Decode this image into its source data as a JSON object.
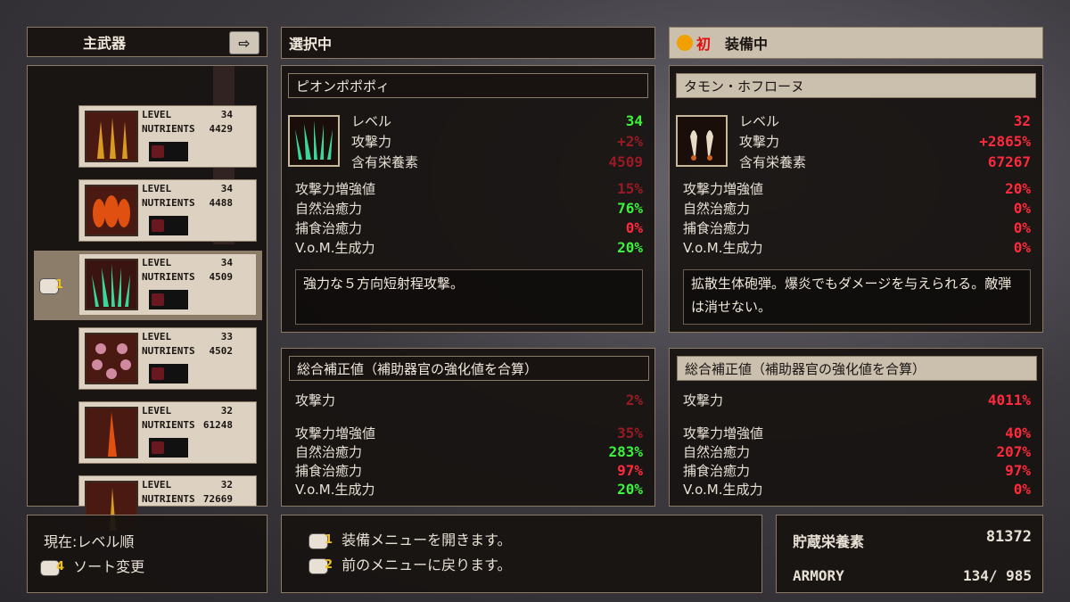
{
  "left_panel": {
    "header": "主武器"
  },
  "weapon_list": [
    {
      "level_label": "LEVEL",
      "level": "34",
      "nutrients_label": "NUTRIENTS",
      "nutrients": "4429",
      "icon": "golden-spikes-icon",
      "locked": true
    },
    {
      "level_label": "LEVEL",
      "level": "34",
      "nutrients_label": "NUTRIENTS",
      "nutrients": "4488",
      "icon": "flame-pods-icon",
      "locked": true
    },
    {
      "level_label": "LEVEL",
      "level": "34",
      "nutrients_label": "NUTRIENTS",
      "nutrients": "4509",
      "icon": "green-spikes-icon",
      "locked": true,
      "selected": true,
      "controller_number": "1"
    },
    {
      "level_label": "LEVEL",
      "level": "33",
      "nutrients_label": "NUTRIENTS",
      "nutrients": "4502",
      "icon": "pink-flowers-icon",
      "locked": true
    },
    {
      "level_label": "LEVEL",
      "level": "32",
      "nutrients_label": "NUTRIENTS",
      "nutrients": "61248",
      "icon": "flame-lance-icon",
      "locked": true
    },
    {
      "level_label": "LEVEL",
      "level": "32",
      "nutrients_label": "NUTRIENTS",
      "nutrients": "72669",
      "icon": "golden-spike-icon",
      "locked": false
    }
  ],
  "sort": {
    "current": "現在:レベル順",
    "controller_number": "4",
    "action": "ソート変更"
  },
  "selected": {
    "header": "選択中",
    "name": "ピオンポポポィ",
    "stats": [
      {
        "label": "レベル",
        "value": "34",
        "color": "green"
      },
      {
        "label": "攻撃力",
        "value": "+2%",
        "color": "dred"
      },
      {
        "label": "含有栄養素",
        "value": "4509",
        "color": "dred"
      }
    ],
    "substats": [
      {
        "label": "攻撃力増強値",
        "value": "15%",
        "color": "dred"
      },
      {
        "label": "自然治癒力",
        "value": "76%",
        "color": "green"
      },
      {
        "label": "捕食治癒力",
        "value": "0%",
        "color": "red"
      },
      {
        "label": "V.o.M.生成力",
        "value": "20%",
        "color": "green"
      }
    ],
    "description": "強力な５方向短射程攻撃。",
    "total_header": "総合補正値（補助器官の強化値を合算）",
    "totals": [
      {
        "label": "攻撃力",
        "value": "2%",
        "color": "dred"
      },
      {
        "label": "攻撃力増強値",
        "value": "35%",
        "color": "dred"
      },
      {
        "label": "自然治癒力",
        "value": "283%",
        "color": "green"
      },
      {
        "label": "捕食治癒力",
        "value": "97%",
        "color": "red"
      },
      {
        "label": "V.o.M.生成力",
        "value": "20%",
        "color": "green"
      }
    ]
  },
  "equipped": {
    "header": "装備中",
    "badge": "初",
    "name": "タモン・ホフローヌ",
    "stats": [
      {
        "label": "レベル",
        "value": "32",
        "color": "red"
      },
      {
        "label": "攻撃力",
        "value": "+2865%",
        "color": "red"
      },
      {
        "label": "含有栄養素",
        "value": "67267",
        "color": "red"
      }
    ],
    "substats": [
      {
        "label": "攻撃力増強値",
        "value": "20%",
        "color": "red"
      },
      {
        "label": "自然治癒力",
        "value": "0%",
        "color": "red"
      },
      {
        "label": "捕食治癒力",
        "value": "0%",
        "color": "red"
      },
      {
        "label": "V.o.M.生成力",
        "value": "0%",
        "color": "red"
      }
    ],
    "description": "拡散生体砲弾。爆炎でもダメージを与えられる。敵弾は消せない。",
    "total_header": "総合補正値（補助器官の強化値を合算）",
    "totals": [
      {
        "label": "攻撃力",
        "value": "4011%",
        "color": "red"
      },
      {
        "label": "攻撃力増強値",
        "value": "40%",
        "color": "red"
      },
      {
        "label": "自然治癒力",
        "value": "207%",
        "color": "red"
      },
      {
        "label": "捕食治癒力",
        "value": "97%",
        "color": "red"
      },
      {
        "label": "V.o.M.生成力",
        "value": "0%",
        "color": "red"
      }
    ]
  },
  "help": [
    {
      "controller_number": "1",
      "text": "装備メニューを開きます。"
    },
    {
      "controller_number": "2",
      "text": "前のメニューに戻ります。"
    }
  ],
  "storage": {
    "label": "貯蔵栄養素",
    "value": "81372",
    "armory_label": "ARMORY",
    "armory_value": "134/ 985"
  }
}
